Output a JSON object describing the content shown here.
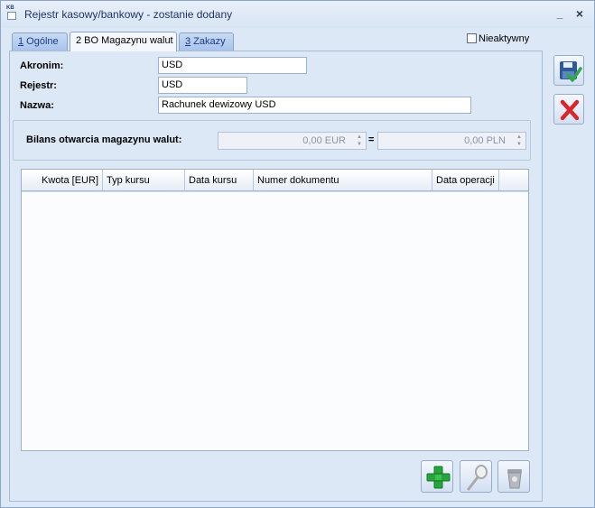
{
  "window": {
    "title": "Rejestr kasowy/bankowy - zostanie dodany",
    "app_badge": "KB",
    "minimize_label": "_",
    "close_label": "×"
  },
  "tabs": [
    {
      "key": "1",
      "label": " Ogólne"
    },
    {
      "key": "2",
      "label": " BO Magazynu walut"
    },
    {
      "key": "3",
      "label": " Zakazy"
    }
  ],
  "inactive": {
    "label": "Nieaktywny",
    "checked": false
  },
  "form": {
    "akronim_label": "Akronim:",
    "akronim_value": "USD",
    "rejestr_label": "Rejestr:",
    "rejestr_value": "USD",
    "nazwa_label": "Nazwa:",
    "nazwa_value": "Rachunek dewizowy USD"
  },
  "bilans": {
    "label": "Bilans otwarcia magazynu walut:",
    "eur_value": "0,00 EUR",
    "equals": "=",
    "pln_value": "0,00 PLN"
  },
  "grid": {
    "columns": [
      "Kwota [EUR]",
      "Typ kursu",
      "Data kursu",
      "Numer dokumentu",
      "Data operacji"
    ],
    "rows": []
  },
  "icons": {
    "save": "save-floppy-check-icon",
    "cancel": "red-x-icon",
    "add": "green-plus-icon",
    "edit": "magnifier-icon",
    "delete": "trash-bin-icon"
  },
  "colors": {
    "accent_add": "#27a43a",
    "accent_cancel": "#d8262b",
    "save_blue": "#2e5a9c"
  }
}
